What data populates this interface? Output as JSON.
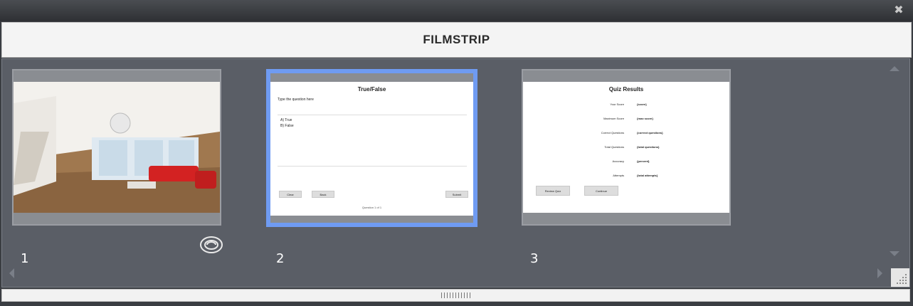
{
  "window": {
    "close_glyph": "✖"
  },
  "header": {
    "title": "FILMSTRIP"
  },
  "slides": [
    {
      "number": "1",
      "kind": "image",
      "icon": "camera-cycle-icon"
    },
    {
      "number": "2",
      "kind": "quiz",
      "title": "True/False",
      "prompt": "Type the question here",
      "options": [
        "A) True",
        "B) False"
      ],
      "buttons": [
        "Clear",
        "Back",
        "Submit"
      ],
      "footer": "Question 1 of 1"
    },
    {
      "number": "3",
      "kind": "results",
      "title": "Quiz Results",
      "rows": [
        {
          "label": "Your Score",
          "value": "{score}"
        },
        {
          "label": "Maximum Score",
          "value": "{max score}"
        },
        {
          "label": "Correct Questions",
          "value": "{correct questions}"
        },
        {
          "label": "Total Questions",
          "value": "{total questions}"
        },
        {
          "label": "Accuracy",
          "value": "{percent}"
        },
        {
          "label": "Attempts",
          "value": "{total attempts}"
        }
      ],
      "buttons": [
        "Review Quiz",
        "Continue"
      ]
    }
  ],
  "colors": {
    "selected_border": "#6f9bf2",
    "strip_bg": "#5a5e66"
  }
}
